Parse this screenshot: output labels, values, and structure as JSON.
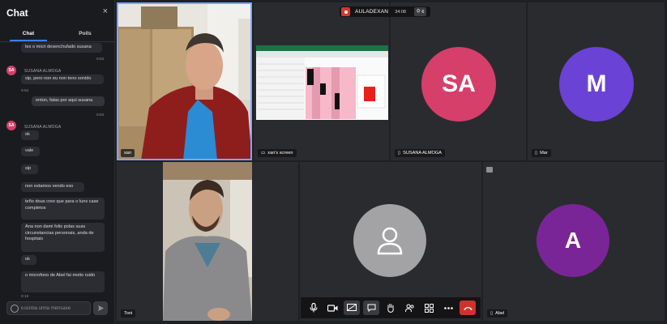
{
  "chat": {
    "title": "Chat",
    "close": "×",
    "tabs": [
      "Chat",
      "Polls"
    ],
    "messages": [
      {
        "text": "tes o micri desenchufado susana",
        "time": "9:52"
      },
      {
        "sender": "SUSANA ALMOGA",
        "avatar": "SA",
        "text": "sip, pero non eu non teno sonido",
        "time": "9:52"
      },
      {
        "text": "enton, falas por aqui susana",
        "time": "9:52"
      },
      {
        "sender": "SUSANA ALMOGA",
        "avatar": "SA",
        "text": "ok"
      },
      {
        "text": "vale"
      },
      {
        "text": "sip"
      },
      {
        "text": "non estamos vendo eso"
      },
      {
        "text": "teño dous creo que para o luns case completos"
      },
      {
        "text": "Ana non dami folis polas suas circunstancias personais, anda de hospitais"
      },
      {
        "text": "ok"
      },
      {
        "text": "o microfono de Abel fai moito ruido",
        "time": "9:15"
      }
    ],
    "input_placeholder": "Escriba unha mensaxe"
  },
  "meeting": {
    "room_name": "AULADEXAN",
    "elapsed": "34:08",
    "participant_count": "6"
  },
  "tiles": {
    "xan": {
      "name": "xan"
    },
    "screen": {
      "name": "xan's screen"
    },
    "susana": {
      "name": "SUSANA ALMOGA",
      "initials": "SA",
      "color": "#d63f6a"
    },
    "mar": {
      "name": "Mar",
      "initials": "M",
      "color": "#6a42d6"
    },
    "toni": {
      "name": "Toni"
    },
    "abel": {
      "name": "Abel",
      "initials": "A",
      "color": "#7a2597"
    }
  },
  "toolbar": [
    "microphone",
    "camera",
    "share-screen",
    "chat",
    "raise-hand",
    "participants",
    "tile-view",
    "more",
    "hang-up"
  ]
}
